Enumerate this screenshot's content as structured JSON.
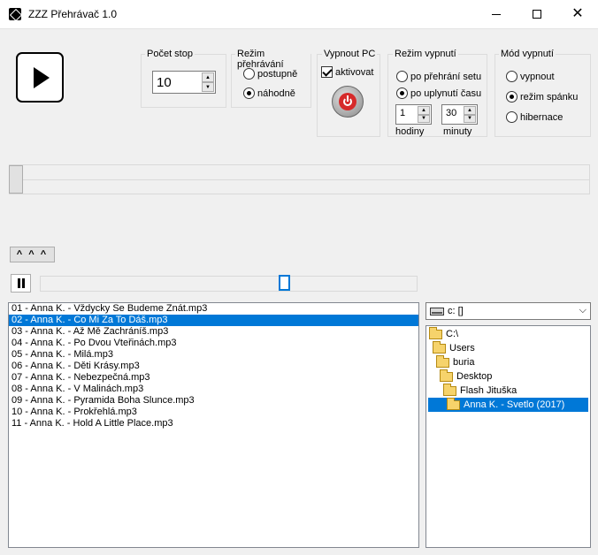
{
  "window": {
    "title": "ZZZ Přehrávač 1.0"
  },
  "controls": {
    "tracks_group": {
      "title": "Počet stop",
      "value": "10"
    },
    "playback_group": {
      "title": "Režim přehrávání",
      "options": [
        "postupně",
        "náhodně"
      ],
      "selected": "náhodně"
    },
    "shutdown_group": {
      "title": "Vypnout PC",
      "activate_label": "aktivovat",
      "checked": true
    },
    "shutdown_mode_group": {
      "title": "Režim vypnutí",
      "options": [
        "po přehrání setu",
        "po uplynutí času"
      ],
      "selected": "po uplynutí času",
      "hours": "1",
      "hours_label": "hodiny",
      "minutes": "30",
      "minutes_label": "minuty"
    },
    "off_mode_group": {
      "title": "Mód vypnutí",
      "options": [
        "vypnout",
        "režim spánku",
        "hibernace"
      ],
      "selected": "režim spánku"
    }
  },
  "carets_label": "^ ^ ^",
  "playlist": {
    "items": [
      "01 - Anna K. - Vždycky Se Budeme Znát.mp3",
      "02 - Anna K. - Co Mi Za To Dáš.mp3",
      "03 - Anna K. - Až Mě Zachráníš.mp3",
      "04 - Anna K. - Po Dvou Vteřinách.mp3",
      "05 - Anna K. - Milá.mp3",
      "06 - Anna K. - Děti Krásy.mp3",
      "07 - Anna K. - Nebezpečná.mp3",
      "08 - Anna K. - V Malinách.mp3",
      "09 - Anna K. - Pyramida Boha Slunce.mp3",
      "10 - Anna K. - Prokřehlá.mp3",
      "11 - Anna K. - Hold A Little Place.mp3"
    ],
    "selected_index": 1
  },
  "drive": {
    "label": "c: []"
  },
  "tree": {
    "items": [
      {
        "label": "C:\\"
      },
      {
        "label": "Users"
      },
      {
        "label": "buria"
      },
      {
        "label": "Desktop"
      },
      {
        "label": "Flash Jituška"
      },
      {
        "label": "Anna K. - Svetlo (2017)"
      }
    ],
    "selected_index": 5
  },
  "colors": {
    "selection": "#0078d7",
    "focus_border": "#0078d7",
    "power_red": "#d62a2a"
  },
  "icons": {
    "app": "app-icon",
    "play": "play-icon",
    "pause": "pause-icon",
    "power": "power-icon",
    "drive": "drive-icon",
    "folder": "folder-icon"
  }
}
